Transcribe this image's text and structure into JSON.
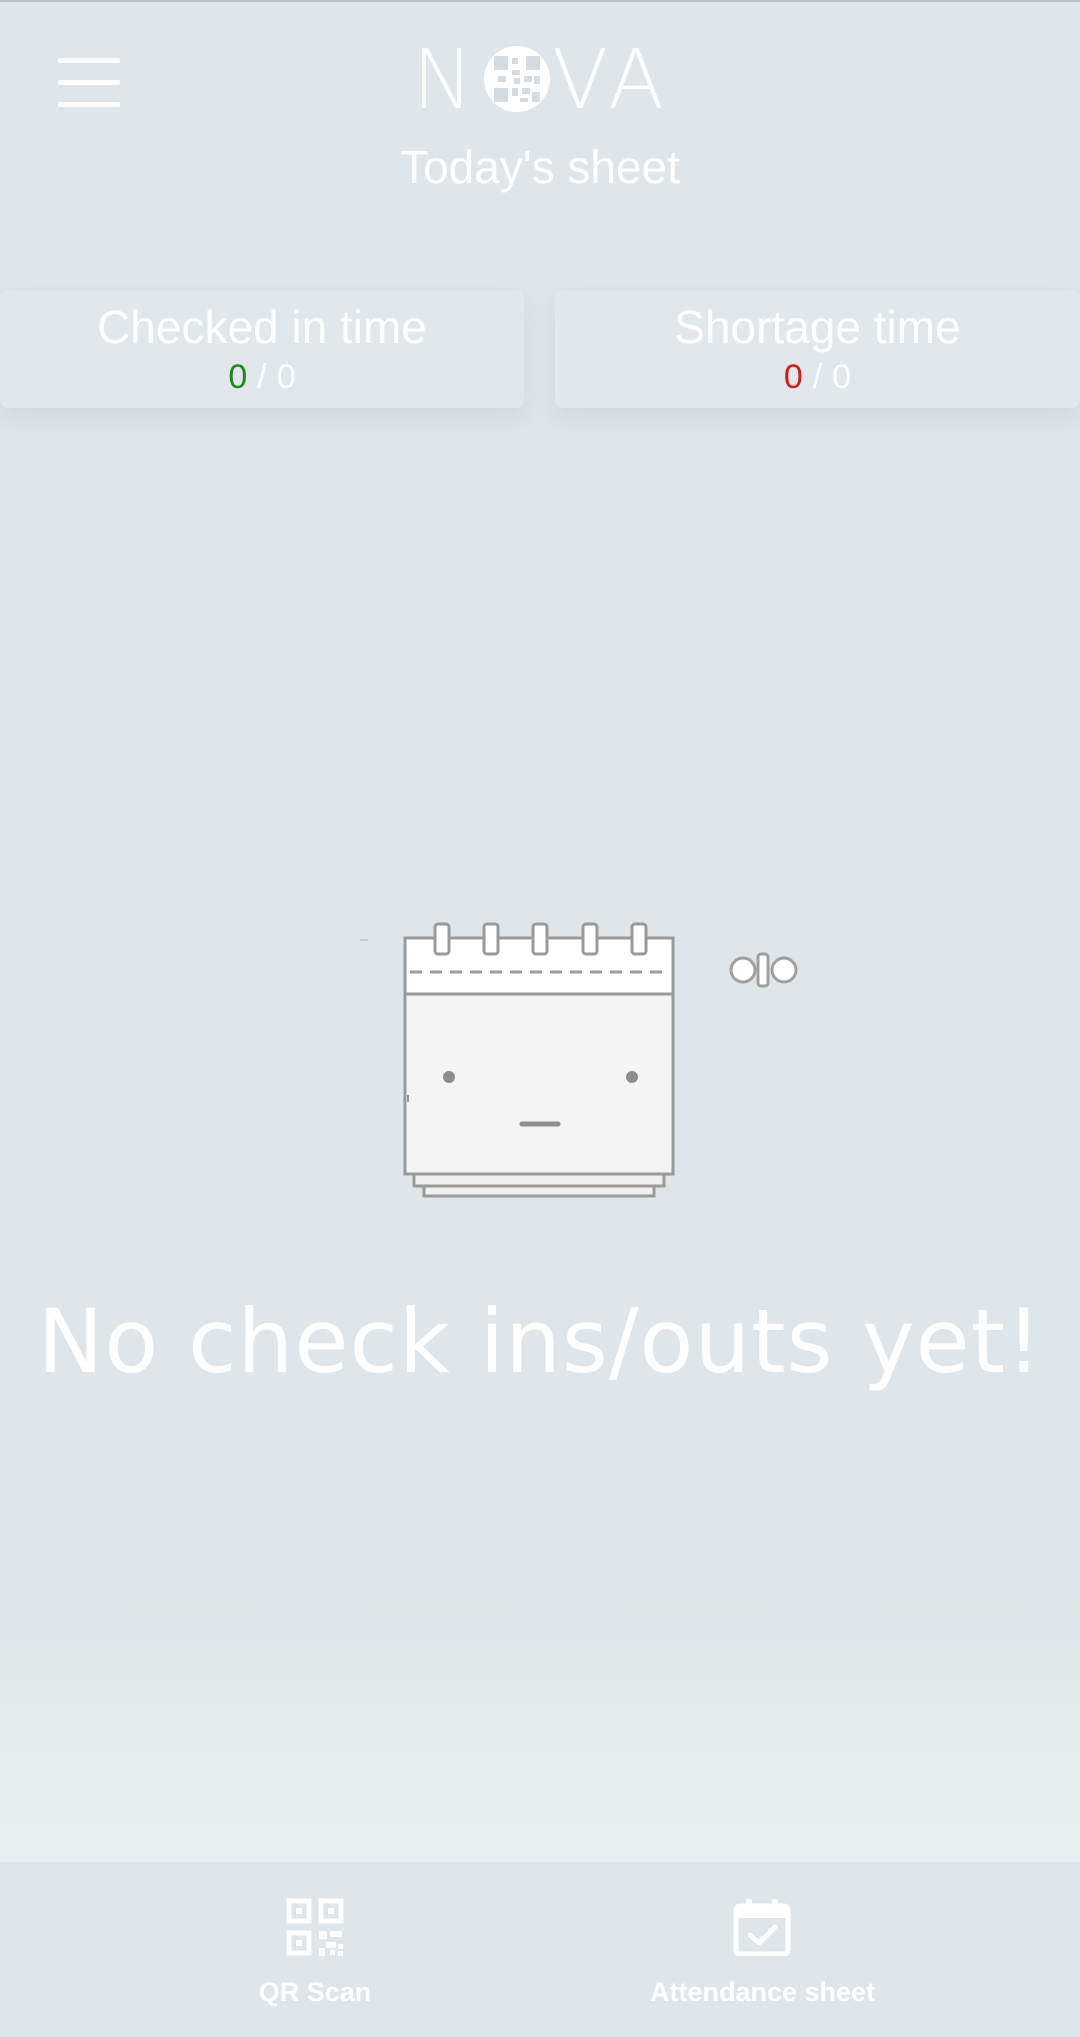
{
  "app": {
    "logo_text": "NOVA",
    "page_title": "Today's sheet"
  },
  "stats": {
    "checked_in": {
      "label": "Checked in time",
      "current": "0",
      "total": "0",
      "current_color": "#1f8a1f"
    },
    "shortage": {
      "label": "Shortage time",
      "current": "0",
      "total": "0",
      "current_color": "#d41a1a"
    },
    "separator": "/"
  },
  "empty_state": {
    "message": "No check ins/outs yet!"
  },
  "bottom_nav": {
    "items": [
      {
        "label": "QR Scan",
        "icon": "qr-code-icon"
      },
      {
        "label": "Attendance sheet",
        "icon": "calendar-check-icon"
      }
    ]
  },
  "colors": {
    "background": "#dfe5e8",
    "text": "#ffffff"
  }
}
